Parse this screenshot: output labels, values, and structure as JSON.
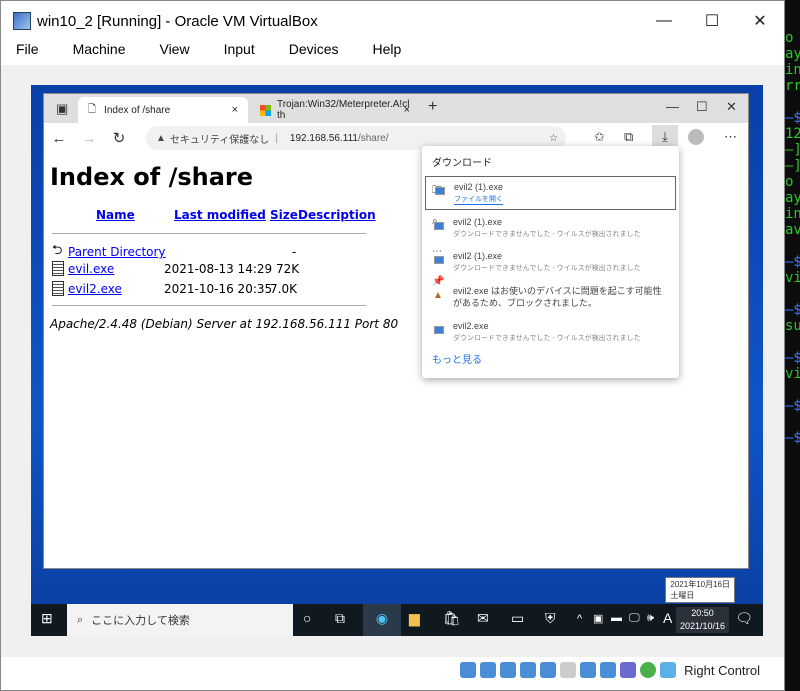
{
  "vbox": {
    "title": "win10_2 [Running] - Oracle VM VirtualBox",
    "menu": [
      "File",
      "Machine",
      "View",
      "Input",
      "Devices",
      "Help"
    ],
    "host_key": "Right Control"
  },
  "browser": {
    "tabs": [
      {
        "label": "Index of /share",
        "close": "×"
      },
      {
        "label": "Trojan:Win32/Meterpreter.A!cl th",
        "close": "×"
      }
    ],
    "new_tab": "+",
    "security": "セキュリティ保護なし",
    "url_host": "192.168.56.111",
    "url_path": "/share/"
  },
  "page": {
    "title": "Index of /share",
    "headers": [
      "Name",
      "Last modified",
      "Size",
      "Description"
    ],
    "rows": [
      {
        "name": "Parent Directory",
        "modified": "",
        "size": "-"
      },
      {
        "name": "evil.exe",
        "modified": "2021-08-13 14:29",
        "size": "72K"
      },
      {
        "name": "evil2.exe",
        "modified": "2021-10-16 20:35",
        "size": "7.0K"
      }
    ],
    "footer": "Apache/2.4.48 (Debian) Server at 192.168.56.111 Port 80"
  },
  "downloads": {
    "title": "ダウンロード",
    "items": [
      {
        "name": "evil2 (1).exe",
        "status": "ファイルを開く"
      },
      {
        "name": "evil2 (1).exe",
        "status": "ダウンロードできませんでした - ウイルスが検出されました"
      },
      {
        "name": "evil2 (1).exe",
        "status": "ダウンロードできませんでした - ウイルスが検出されました"
      },
      {
        "name": "evil2.exe はお使いのデバイスに問題を起こす可能性があるため、ブロックされました。",
        "status": ""
      },
      {
        "name": "evil2.exe",
        "status": "ダウンロードできませんでした - ウイルスが検出されました"
      }
    ],
    "more": "もっと見る"
  },
  "taskbar": {
    "search_placeholder": "ここに入力して検索",
    "ime": "A",
    "time": "20:50",
    "date": "2021/10/16",
    "tooltip_date": "2021年10月16日",
    "tooltip_day": "土曜日"
  },
  "terminal": {
    "lines": [
      "o",
      "ay",
      "in",
      "rr",
      "",
      "—$",
      "12",
      "—]",
      "—]",
      "o",
      "ay",
      "in",
      "av",
      "",
      "—$",
      "vi",
      "",
      "—$",
      "su",
      "",
      "—$",
      "vi",
      "",
      "—$",
      "",
      "—$"
    ]
  }
}
